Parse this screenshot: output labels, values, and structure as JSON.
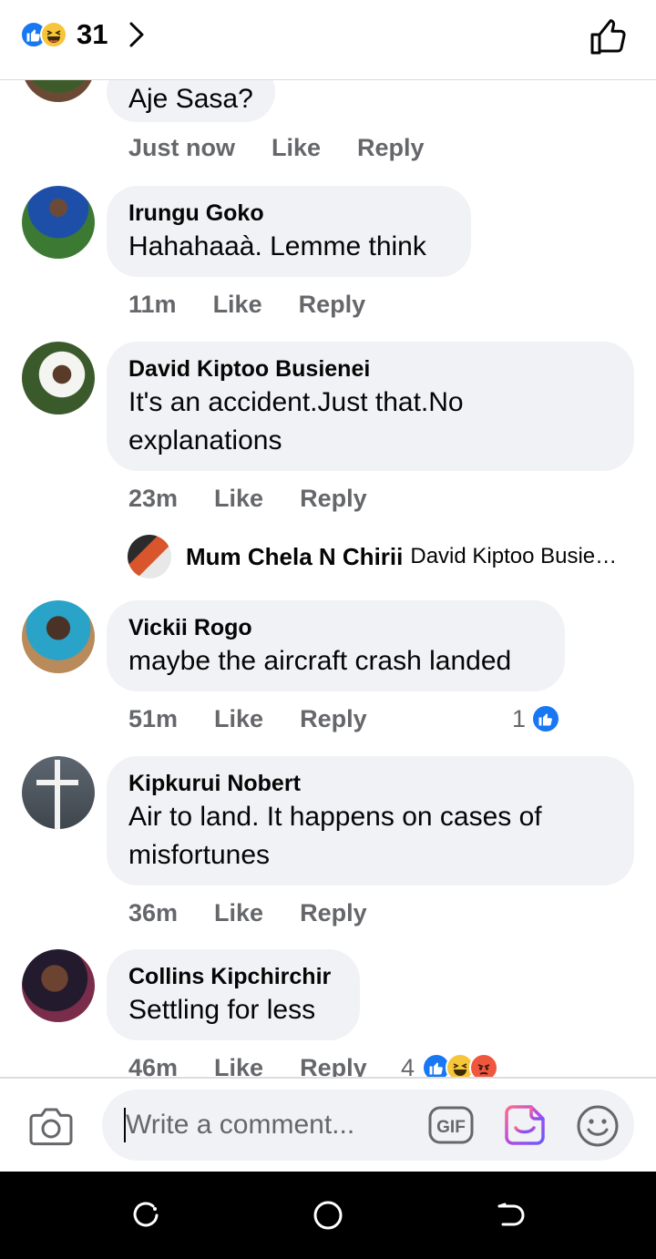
{
  "header": {
    "reaction_count": "31",
    "reaction_icons": [
      "like-icon",
      "haha-icon"
    ],
    "like_button_icon": "thumbs-up-outline-icon"
  },
  "comments": [
    {
      "name": "",
      "text": "Aje Sasa?",
      "time": "Just now",
      "like": "Like",
      "reply": "Reply"
    },
    {
      "name": "Irungu Goko",
      "text": "Hahahaaà. Lemme think",
      "time": "11m",
      "like": "Like",
      "reply": "Reply"
    },
    {
      "name": "David Kiptoo Busienei",
      "text_lines": [
        "It's an accident.Just that.No",
        "explanations"
      ],
      "time": "23m",
      "like": "Like",
      "reply": "Reply",
      "reply_preview": {
        "name": "Mum Chela N Chirii",
        "text": "David Kiptoo Busie…"
      }
    },
    {
      "name": "Vickii Rogo",
      "text": "maybe the aircraft crash landed",
      "time": "51m",
      "like": "Like",
      "reply": "Reply",
      "reaction_count": "1"
    },
    {
      "name": "Kipkurui Nobert",
      "text_lines": [
        "Air to land. It happens on cases of",
        "misfortunes"
      ],
      "time": "36m",
      "like": "Like",
      "reply": "Reply"
    },
    {
      "name": "Collins Kipchirchir",
      "text": "Settling for less",
      "time": "46m",
      "like": "Like",
      "reply": "Reply",
      "reaction_count": "4"
    }
  ],
  "composer": {
    "placeholder": "Write a comment...",
    "gif_label": "GIF"
  },
  "colors": {
    "facebook_blue": "#1877f2",
    "bubble_bg": "#f0f2f5",
    "meta_gray": "#65676b",
    "haha_yellow": "#f7c53a",
    "angry_red": "#f0563d"
  }
}
